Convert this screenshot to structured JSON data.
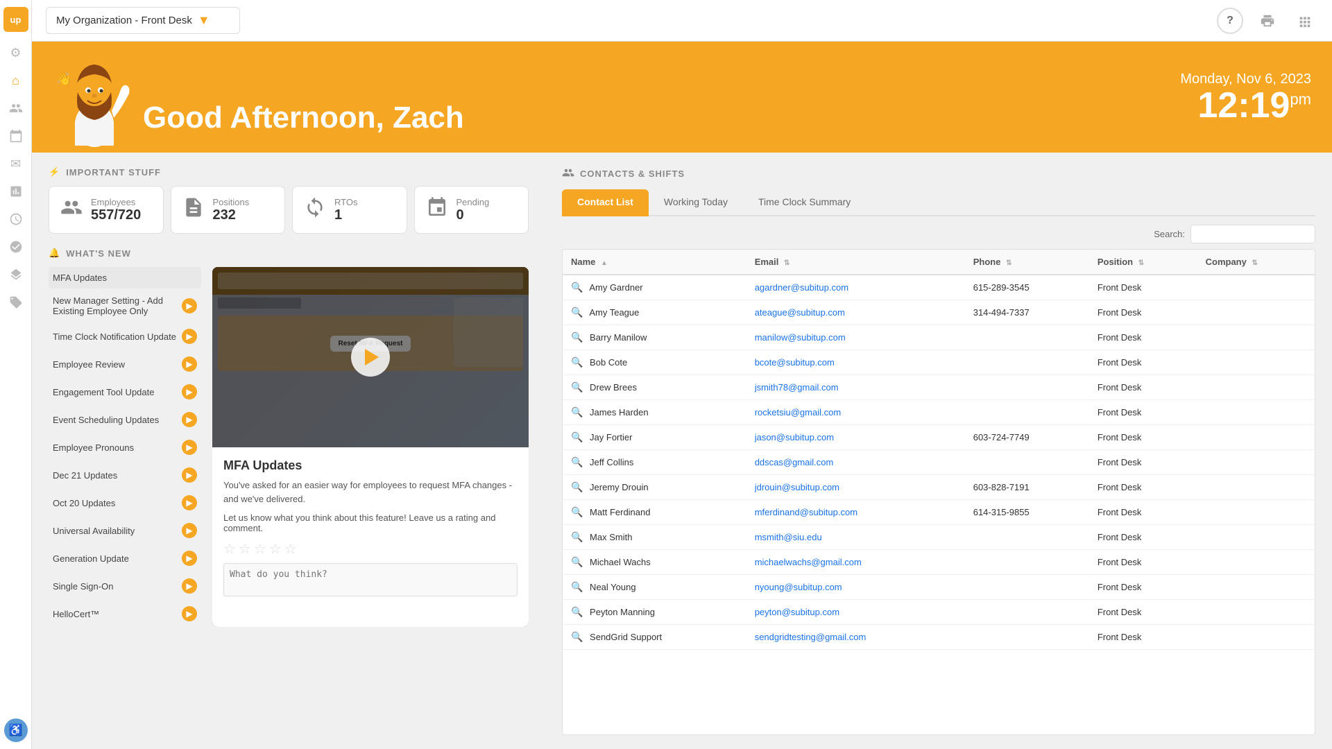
{
  "app": {
    "logo": "up",
    "org_selector": "My Organization - Front Desk"
  },
  "topbar": {
    "org": "My Organization - Front Desk",
    "help_icon": "?",
    "print_icon": "🖨",
    "grid_icon": "⊞"
  },
  "hero": {
    "greeting": "Good Afternoon, Zach",
    "date": "Monday, Nov 6, 2023",
    "time": "12:19",
    "time_suffix": "pm"
  },
  "sidebar": {
    "items": [
      {
        "name": "settings-icon",
        "glyph": "⚙",
        "active": false
      },
      {
        "name": "home-icon",
        "glyph": "⌂",
        "active": false
      },
      {
        "name": "people-icon",
        "glyph": "👥",
        "active": false
      },
      {
        "name": "calendar-icon",
        "glyph": "📅",
        "active": false
      },
      {
        "name": "mail-icon",
        "glyph": "✉",
        "active": false
      },
      {
        "name": "chart-icon",
        "glyph": "📊",
        "active": false
      },
      {
        "name": "clock-icon",
        "glyph": "⏱",
        "active": false
      },
      {
        "name": "user-icon",
        "glyph": "👤",
        "active": false
      },
      {
        "name": "layers-icon",
        "glyph": "◫",
        "active": false
      },
      {
        "name": "tag-icon",
        "glyph": "🏷",
        "active": false
      },
      {
        "name": "accessibility-icon",
        "glyph": "♿",
        "active": false
      }
    ]
  },
  "important_stuff": {
    "title": "IMPORTANT STUFF",
    "stats": [
      {
        "label": "Employees",
        "value": "557/720",
        "icon": "👥"
      },
      {
        "label": "Positions",
        "value": "232",
        "icon": "📋"
      },
      {
        "label": "RTOs",
        "value": "1",
        "icon": "🔄"
      },
      {
        "label": "Pending",
        "value": "0",
        "icon": "📝"
      }
    ]
  },
  "whats_new": {
    "title": "WHAT'S NEW",
    "items": [
      {
        "label": "MFA Updates",
        "active": true
      },
      {
        "label": "New Manager Setting - Add Existing Employee Only",
        "active": false
      },
      {
        "label": "Time Clock Notification Update",
        "active": false
      },
      {
        "label": "Employee Review",
        "active": false
      },
      {
        "label": "Engagement Tool Update",
        "active": false
      },
      {
        "label": "Event Scheduling Updates",
        "active": false
      },
      {
        "label": "Employee Pronouns",
        "active": false
      },
      {
        "label": "Dec 21 Updates",
        "active": false
      },
      {
        "label": "Oct 20 Updates",
        "active": false
      },
      {
        "label": "Universal Availability",
        "active": false
      },
      {
        "label": "Generation Update",
        "active": false
      },
      {
        "label": "Single Sign-On",
        "active": false
      },
      {
        "label": "HelloCert™",
        "active": false
      }
    ],
    "active_title": "MFA Updates",
    "active_desc": "You've asked for an easier way for employees to request MFA changes - and we've delivered.",
    "active_prompt": "Let us know what you think about this feature! Leave us a rating and comment.",
    "comment_placeholder": "What do you think?"
  },
  "contacts": {
    "title": "CONTACTS & SHIFTS",
    "tabs": [
      {
        "label": "Contact List",
        "active": true
      },
      {
        "label": "Working Today",
        "active": false
      },
      {
        "label": "Time Clock Summary",
        "active": false
      }
    ],
    "search_label": "Search:",
    "search_placeholder": "",
    "columns": [
      "Name",
      "Email",
      "Phone",
      "Position",
      "Company"
    ],
    "rows": [
      {
        "name": "Amy Gardner",
        "email": "agardner@subitup.com",
        "phone": "615-289-3545",
        "position": "Front Desk",
        "company": ""
      },
      {
        "name": "Amy Teague",
        "email": "ateague@subitup.com",
        "phone": "314-494-7337",
        "position": "Front Desk",
        "company": ""
      },
      {
        "name": "Barry Manilow",
        "email": "manilow@subitup.com",
        "phone": "",
        "position": "Front Desk",
        "company": ""
      },
      {
        "name": "Bob Cote",
        "email": "bcote@subitup.com",
        "phone": "",
        "position": "Front Desk",
        "company": ""
      },
      {
        "name": "Drew Brees",
        "email": "jsmith78@gmail.com",
        "phone": "",
        "position": "Front Desk",
        "company": ""
      },
      {
        "name": "James Harden",
        "email": "rocketsiu@gmail.com",
        "phone": "",
        "position": "Front Desk",
        "company": ""
      },
      {
        "name": "Jay Fortier",
        "email": "jason@subitup.com",
        "phone": "603-724-7749",
        "position": "Front Desk",
        "company": ""
      },
      {
        "name": "Jeff Collins",
        "email": "ddscas@gmail.com",
        "phone": "",
        "position": "Front Desk",
        "company": ""
      },
      {
        "name": "Jeremy Drouin",
        "email": "jdrouin@subitup.com",
        "phone": "603-828-7191",
        "position": "Front Desk",
        "company": ""
      },
      {
        "name": "Matt Ferdinand",
        "email": "mferdinand@subitup.com",
        "phone": "614-315-9855",
        "position": "Front Desk",
        "company": ""
      },
      {
        "name": "Max Smith",
        "email": "msmith@siu.edu",
        "phone": "",
        "position": "Front Desk",
        "company": ""
      },
      {
        "name": "Michael Wachs",
        "email": "michaelwachs@gmail.com",
        "phone": "",
        "position": "Front Desk",
        "company": ""
      },
      {
        "name": "Neal Young",
        "email": "nyoung@subitup.com",
        "phone": "",
        "position": "Front Desk",
        "company": ""
      },
      {
        "name": "Peyton Manning",
        "email": "peyton@subitup.com",
        "phone": "",
        "position": "Front Desk",
        "company": ""
      },
      {
        "name": "SendGrid Support",
        "email": "sendgridtesting@gmail.com",
        "phone": "",
        "position": "Front Desk",
        "company": ""
      }
    ]
  }
}
